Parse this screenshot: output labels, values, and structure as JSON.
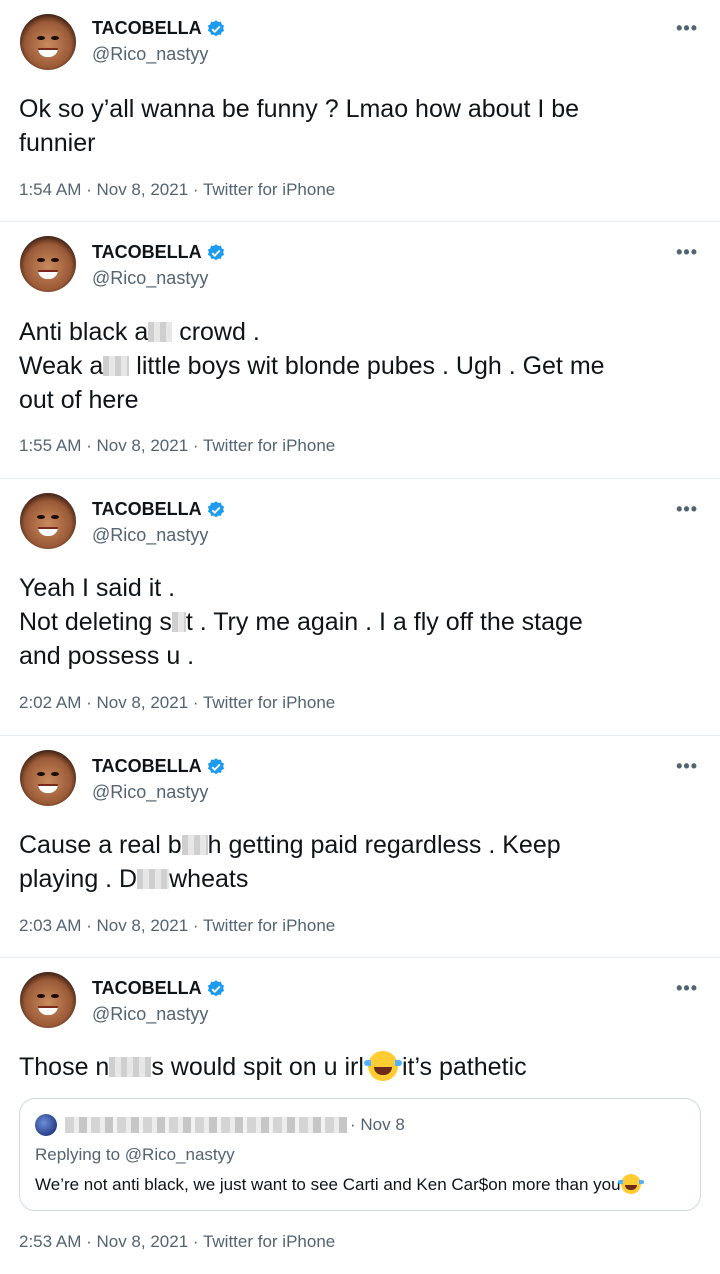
{
  "author": {
    "display_name": "TACOBELLA",
    "handle": "@Rico_nastyy",
    "verified_icon": "verified-badge-icon",
    "verified_color": "#1d9bf0"
  },
  "more_label": "•••",
  "tweets": [
    {
      "lines": [
        "Ok so y’all wanna be funny ? Lmao how about I be",
        "funnier"
      ],
      "meta": "1:54 AM · Nov 8, 2021 · Twitter for iPhone"
    },
    {
      "text": {
        "l1_a": "Anti black a",
        "l1_b": " crowd .",
        "l2_a": "Weak a",
        "l2_b": " little boys wit blonde pubes . Ugh . Get me",
        "l3": "out of here"
      },
      "meta": "1:55 AM · Nov 8, 2021 · Twitter for iPhone"
    },
    {
      "text": {
        "l1": "Yeah I said it .",
        "l2_a": "Not deleting s",
        "l2_b": "t . Try me again . I a fly off the stage",
        "l3": "and possess u ."
      },
      "meta": "2:02 AM · Nov 8, 2021 · Twitter for iPhone"
    },
    {
      "text": {
        "l1_a": "Cause a real b",
        "l1_b": "h getting paid regardless . Keep",
        "l2_a": "playing . D",
        "l2_b": "wheats"
      },
      "meta": "2:03 AM · Nov 8, 2021 · Twitter for iPhone"
    },
    {
      "text": {
        "l1_a": "Those n",
        "l1_b": "s would spit on u irl",
        "l1_c": "it’s pathetic"
      },
      "emoji": "face-with-tears-of-joy-icon",
      "quote": {
        "date": "· Nov 8",
        "replying_prefix": "Replying to ",
        "replying_handle": "@Rico_nastyy",
        "text": "We’re not anti black, we just want to see Carti and Ken Car$on more than you"
      },
      "meta": "2:53 AM · Nov 8, 2021 · Twitter for iPhone"
    }
  ]
}
